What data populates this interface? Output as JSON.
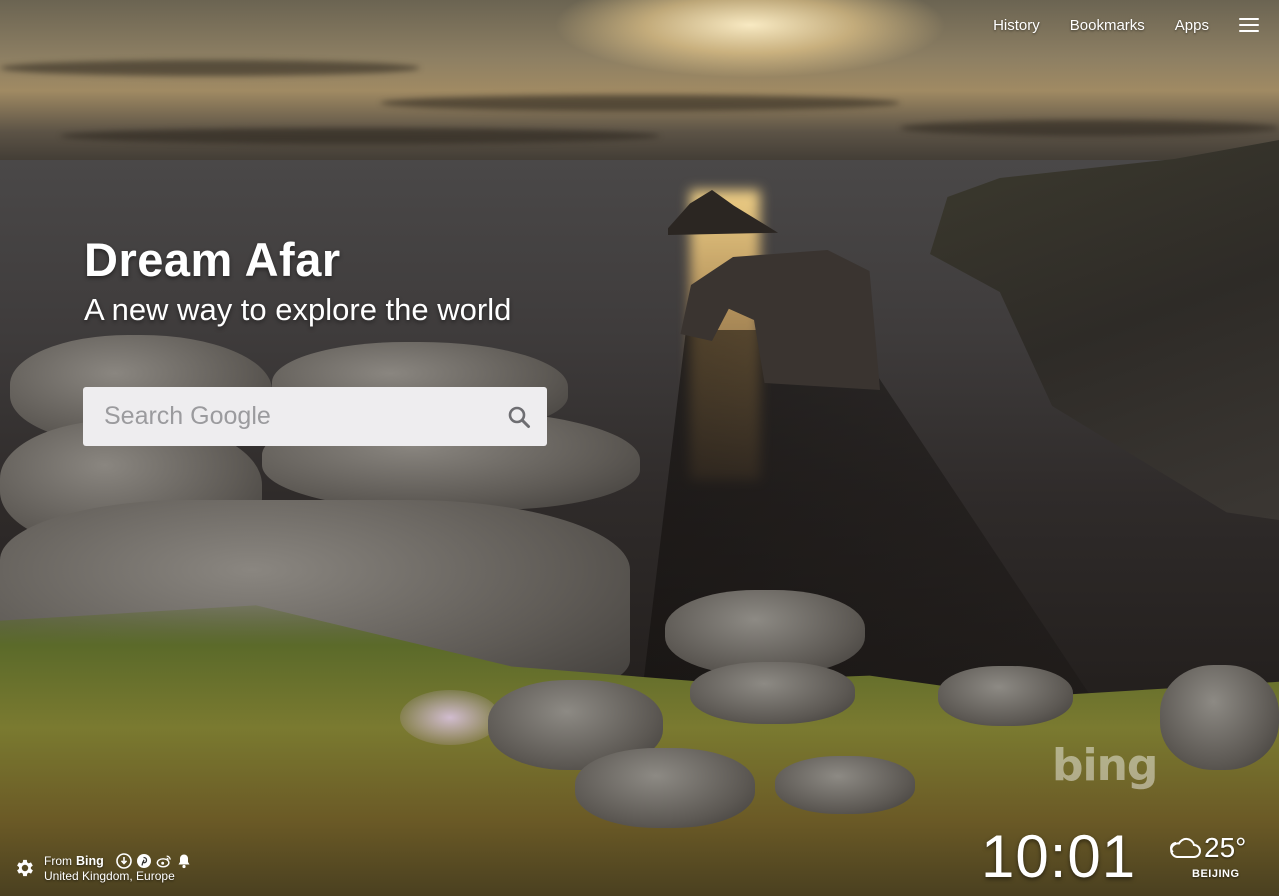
{
  "nav": {
    "history_label": "History",
    "bookmarks_label": "Bookmarks",
    "apps_label": "Apps",
    "menu_icon": "hamburger-menu-icon"
  },
  "hero": {
    "title": "Dream Afar",
    "subtitle": "A new way to explore the world"
  },
  "search": {
    "placeholder": "Search Google",
    "value": "",
    "icon": "search-icon"
  },
  "source": {
    "from_label": "From",
    "provider": "Bing",
    "location": "United Kingdom, Europe",
    "settings_icon": "gear-icon",
    "share_icons": [
      "download-icon",
      "pinterest-icon",
      "weibo-icon",
      "notification-bell-icon"
    ]
  },
  "watermark": {
    "text": "bing"
  },
  "clock": {
    "time": "10:01"
  },
  "weather": {
    "icon": "cloud-icon",
    "temperature": "25°",
    "city": "BEIJING"
  },
  "colors": {
    "search_bg": "#eeedef",
    "placeholder": "#9b9b9e",
    "text": "#ffffff"
  }
}
